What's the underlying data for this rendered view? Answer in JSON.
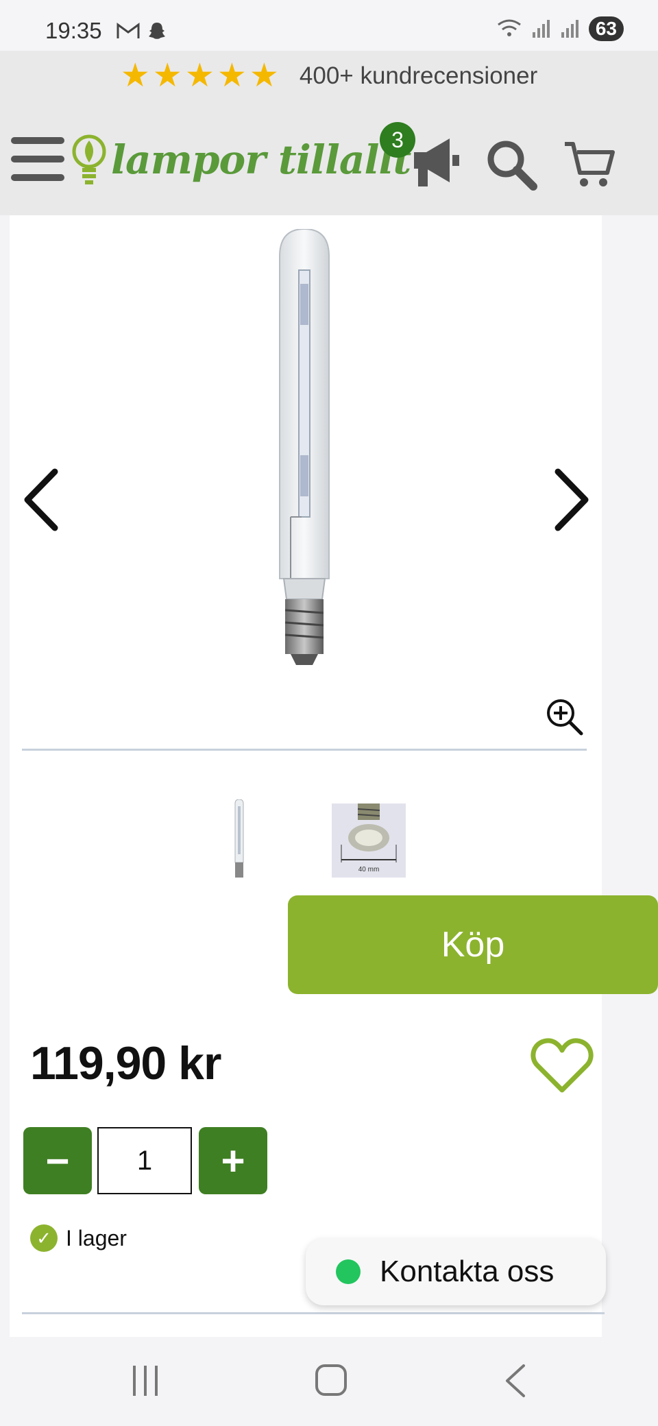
{
  "status_bar": {
    "time": "19:35",
    "battery": "63"
  },
  "reviews": {
    "stars": [
      "★",
      "★",
      "★",
      "★",
      "★"
    ],
    "text": "400+ kundrecensioner"
  },
  "header": {
    "logo_text": "lampor tillallt",
    "announce_badge": "3"
  },
  "product": {
    "price": "119,90 kr",
    "quantity": "1",
    "minus_label": "−",
    "plus_label": "+",
    "buy_label": "Köp",
    "stock_check": "✓",
    "stock_text": "I lager",
    "thumb2_label": "40 mm"
  },
  "contact": {
    "label": "Kontakta oss"
  },
  "colors": {
    "brand_green": "#8cb32e",
    "dark_green": "#3f7f23",
    "star_yellow": "#f5b800",
    "online_dot": "#22c55e"
  },
  "icons": {
    "menu": "menu-icon",
    "announce": "megaphone-icon",
    "search": "search-icon",
    "cart": "cart-icon",
    "zoom": "zoom-in-icon",
    "heart": "heart-icon"
  }
}
